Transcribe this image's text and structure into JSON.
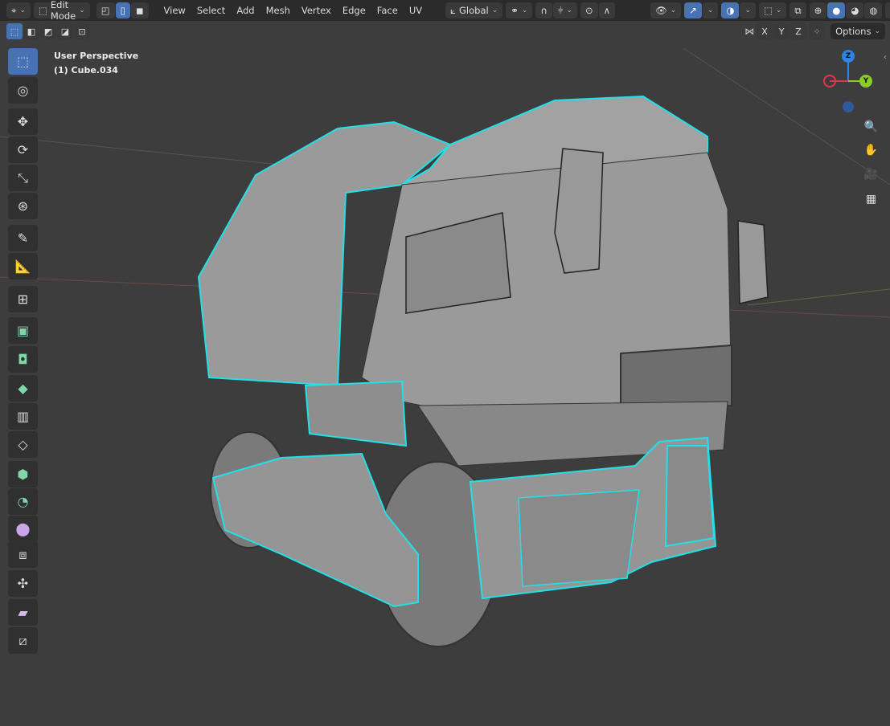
{
  "header": {
    "editor_type_icon": "object-gizmo-icon",
    "mode": "Edit Mode",
    "select_modes": [
      "vertex",
      "edge",
      "face"
    ],
    "active_select_mode": "edge",
    "menus": [
      "View",
      "Select",
      "Add",
      "Mesh",
      "Vertex",
      "Edge",
      "Face",
      "UV"
    ],
    "transform_orientation": "Global",
    "shading_modes": [
      "wireframe",
      "solid",
      "material",
      "rendered"
    ],
    "active_shading": "solid"
  },
  "subheader": {
    "axes": [
      "X",
      "Y",
      "Z"
    ],
    "options_label": "Options"
  },
  "viewport": {
    "perspective": "User Perspective",
    "object": "(1) Cube.034"
  },
  "gizmo": {
    "axes": [
      "Z",
      "Y",
      "X"
    ],
    "colors": {
      "x": "#e2344d",
      "y": "#8ccc29",
      "z": "#2f83e3"
    }
  },
  "toolbar": [
    "select-box",
    "cursor",
    "move",
    "rotate",
    "scale",
    "transform",
    "annotate",
    "measure",
    "add-cube",
    "extrude",
    "inset",
    "bevel",
    "loop-cut",
    "knife",
    "poly-build",
    "spin",
    "smooth",
    "edge-slide",
    "shrink-fatten",
    "shear",
    "rip-region"
  ],
  "active_tool": "select-box",
  "colors": {
    "accent": "#4772b3",
    "selection_edges": "#22e0e8",
    "viewport_bg": "#3d3d3d"
  }
}
